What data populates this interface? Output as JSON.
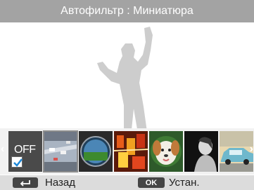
{
  "title": "Автофильтр : Миниатюра",
  "filters": [
    {
      "name": "off",
      "label": "OFF",
      "checked": true
    },
    {
      "name": "miniature",
      "selected": true
    },
    {
      "name": "vignetting"
    },
    {
      "name": "fisheye"
    },
    {
      "name": "dog"
    },
    {
      "name": "classic"
    },
    {
      "name": "car"
    }
  ],
  "softkeys": {
    "back_label": "Назад",
    "ok_key": "OK",
    "ok_label": "Устан."
  },
  "icons": {
    "back": "return-arrow-icon",
    "left_arrow": "chevron-left-icon",
    "right_arrow": "chevron-right-icon",
    "check": "checkmark-icon"
  },
  "colors": {
    "title_bar": "#a3a3a3",
    "bottom_bar": "#dcdcdc",
    "check": "#1e88d8"
  }
}
